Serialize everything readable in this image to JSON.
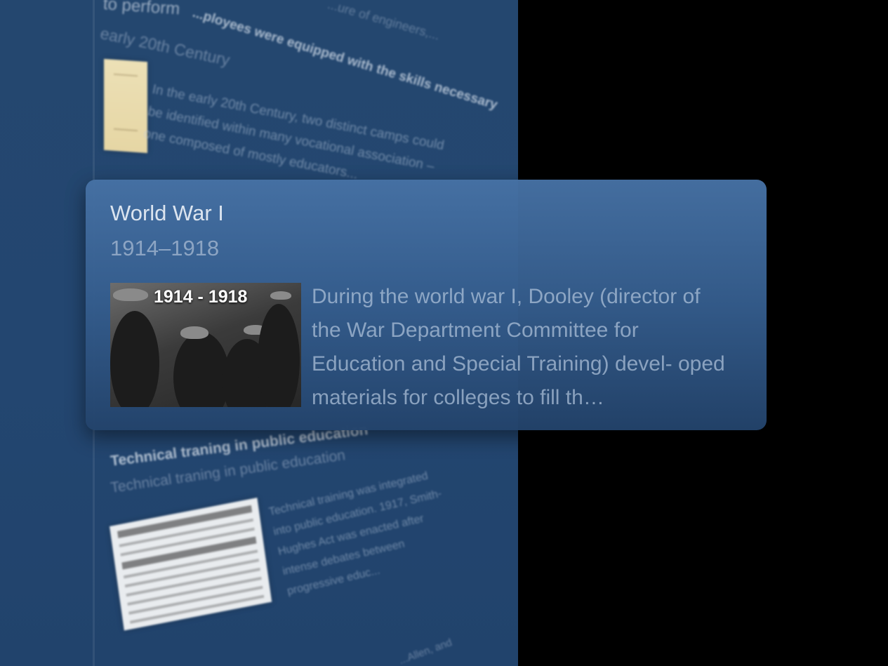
{
  "background": {
    "top_entry": {
      "header_fragment": "...ure of engineers,...",
      "title_fragment": "to perform",
      "subtitle_fragment": "...ployees were equipped with the skills necessary",
      "date": "early 20th Century",
      "body": "In the early 20th Century, two distinct camps could be identified within many vocational association – one composed of mostly educators..."
    },
    "bottom_entry": {
      "title": "Technical traning in public education",
      "subtitle": "Technical traning in public education",
      "body": "Technical training was integrated into public education. 1917, Smith-Hughes Act was enacted after intense debates between progressive educ...",
      "footer_fragment": "...Allen, and"
    }
  },
  "card": {
    "title": "World War I",
    "date": "1914–1918",
    "image_caption": "1914 - 1918",
    "description": "During the world war I, Dooley (director of the War Department Committee for Education and Special Training) devel- oped materials for colleges to fill th…"
  },
  "colors": {
    "panel": "#24476f",
    "card_top": "#4671a4",
    "card_bottom": "#23436b",
    "title_text": "#dbe4ef"
  }
}
